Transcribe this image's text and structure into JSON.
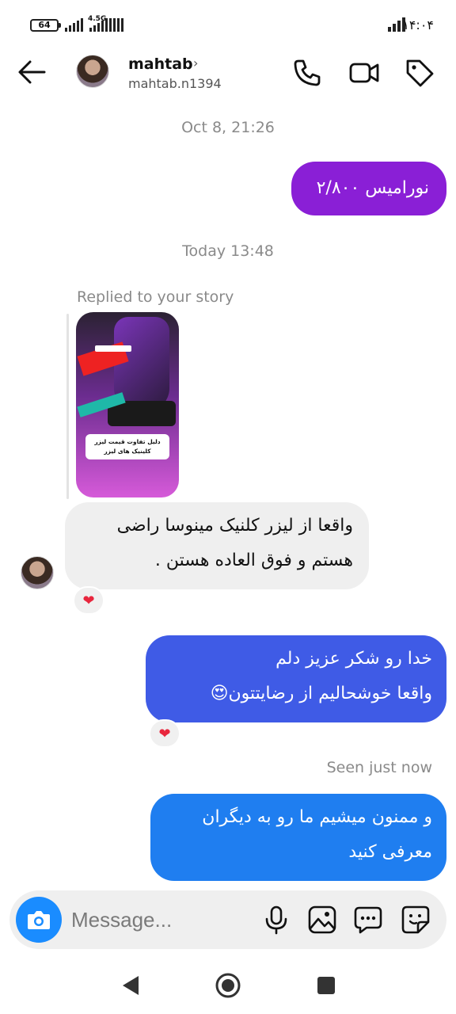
{
  "status_bar": {
    "battery": "64",
    "network": "4.5G",
    "time": "۱۴:۰۴"
  },
  "header": {
    "username": "mahtab",
    "chevron": "›",
    "handle": "mahtab.n1394"
  },
  "chat": {
    "timestamp_1": "Oct 8, 21:26",
    "msg_out_1": "نورامیس ۲/۸۰۰",
    "timestamp_2": "Today 13:48",
    "replied_label": "Replied to your story",
    "story_caption_line1": "دلیل تفاوت قیمت لیزر",
    "story_caption_line2": "کلینیک های لیزر",
    "msg_in_1": "واقعا از لیزر کلنیک مینوسا راضی هستم و فوق العاده هستن  .",
    "reaction_1": "❤",
    "msg_out_2_line1": "خدا رو شکر عزیز دلم",
    "msg_out_2_line2": "واقعا خوشحالیم از رضایتتون😍",
    "reaction_2": "❤",
    "seen_label": "Seen just now",
    "msg_out_3": "و ممنون میشیم ما رو به دیگران معرفی کنید"
  },
  "composer": {
    "placeholder": "Message..."
  },
  "colors": {
    "bubble_purple": "#8a1fd6",
    "bubble_indigo": "#3f5be6",
    "bubble_blue": "#1f7ef0",
    "accent_blue": "#1a8cff"
  },
  "icons": [
    "back-arrow-icon",
    "phone-icon",
    "video-camera-icon",
    "tag-icon",
    "camera-icon",
    "microphone-icon",
    "gallery-icon",
    "chat-bubble-icon",
    "sticker-icon",
    "nav-back-icon",
    "nav-home-icon",
    "nav-recents-icon"
  ]
}
